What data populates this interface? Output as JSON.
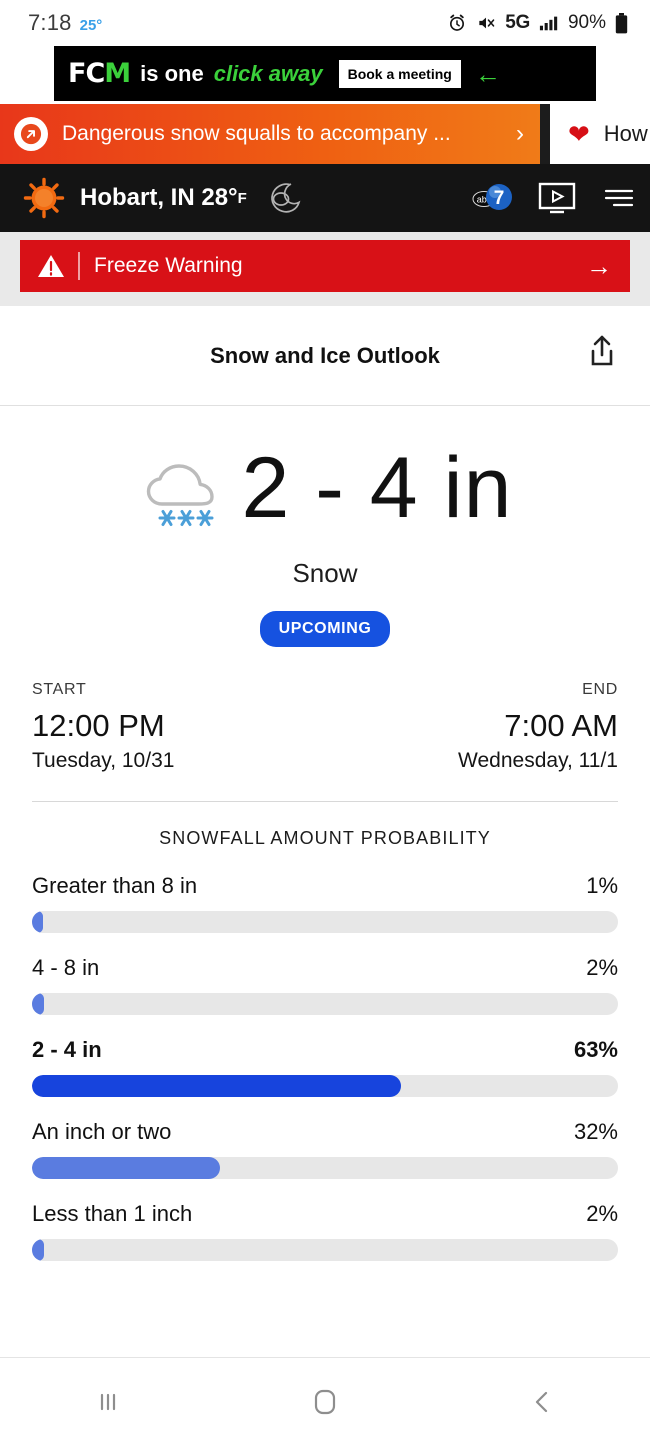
{
  "statusbar": {
    "time": "7:18",
    "temperature": "25°",
    "network": "5G",
    "battery": "90%",
    "icons": [
      "alarm-icon",
      "mute-icon",
      "signal-icon",
      "battery-icon"
    ]
  },
  "ad": {
    "logo_prefix": "FC",
    "logo_accent": "M",
    "headline_plain": "is one",
    "headline_accent": "click away",
    "cta_label": "Book a meeting"
  },
  "carousel": {
    "alert_card": {
      "title": "Dangerous snow squalls to accompany ...",
      "chevron": "›"
    },
    "second_card": {
      "title": "How"
    }
  },
  "header": {
    "location": "Hobart, IN",
    "temperature": "28°",
    "unit": "F",
    "station": "abc7",
    "icons": [
      "sun-logo",
      "night-cloud-icon",
      "abc7-logo",
      "live-tv-icon",
      "menu-icon"
    ]
  },
  "warning": {
    "label": "Freeze Warning",
    "color": "#d81117",
    "arrow": "→"
  },
  "panel": {
    "title": "Snow and Ice Outlook"
  },
  "hero": {
    "amount": "2 - 4 in",
    "condition": "Snow",
    "status_badge": "UPCOMING",
    "badge_color": "#1652e0"
  },
  "timing": {
    "start_label": "START",
    "start_time": "12:00 PM",
    "start_date": "Tuesday, 10/31",
    "end_label": "END",
    "end_time": "7:00 AM",
    "end_date": "Wednesday, 11/1"
  },
  "chart_data": {
    "type": "bar",
    "title": "SNOWFALL AMOUNT PROBABILITY",
    "xlabel": "",
    "ylabel": "",
    "ylim": [
      0,
      100
    ],
    "orientation": "horizontal",
    "grid": false,
    "legend": "none",
    "categories": [
      "Greater than 8 in",
      "4 - 8 in",
      "2 - 4 in",
      "An inch or two",
      "Less than 1 inch"
    ],
    "values": [
      1,
      2,
      63,
      32,
      2
    ],
    "value_labels": [
      "1%",
      "2%",
      "63%",
      "32%",
      "2%"
    ],
    "highlight_index": 2,
    "colors": {
      "bar": "#5a7ce0",
      "bar_highlight": "#1744dd",
      "track": "#e7e7e7"
    }
  },
  "navbar": {
    "recents": "recent-apps-icon",
    "home": "home-icon",
    "back": "back-icon"
  }
}
